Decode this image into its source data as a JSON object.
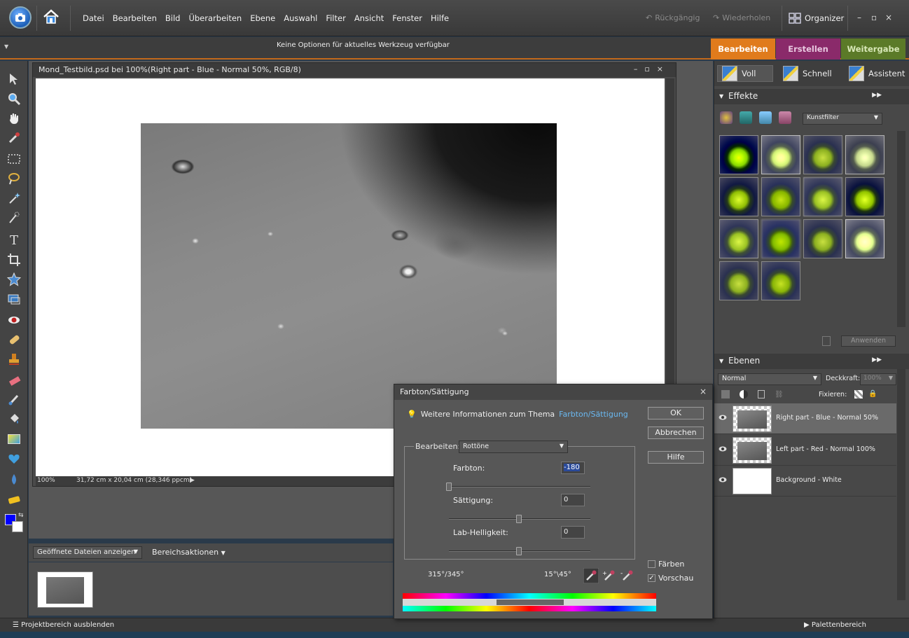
{
  "menubar": {
    "menus": [
      "Datei",
      "Bearbeiten",
      "Bild",
      "Überarbeiten",
      "Ebene",
      "Auswahl",
      "Filter",
      "Ansicht",
      "Fenster",
      "Hilfe"
    ],
    "undo_label": "Rückgängig",
    "redo_label": "Wiederholen",
    "organizer_label": "Organizer"
  },
  "options_bar": {
    "message": "Keine Optionen für aktuelles Werkzeug verfügbar",
    "tabs": [
      "Bearbeiten",
      "Erstellen",
      "Weitergabe"
    ]
  },
  "document": {
    "title": "Mond_Testbild.psd bei 100%(Right part - Blue - Normal 50%, RGB/8)",
    "zoom": "100%",
    "dimensions": "31,72 cm x 20,04 cm (28,346 ppcm)"
  },
  "project_bin": {
    "dropdown": "Geöffnete Dateien anzeigen",
    "actions_label": "Bereichsaktionen"
  },
  "statusbar": {
    "left": "Projektbereich ausblenden",
    "right": "Palettenbereich"
  },
  "palette": {
    "modes": [
      "Voll",
      "Schnell",
      "Assistent"
    ],
    "effects_title": "Effekte",
    "effects_category": "Kunstfilter",
    "apply_label": "Anwenden",
    "layers_title": "Ebenen",
    "blend_mode": "Normal",
    "opacity_label": "Deckkraft:",
    "opacity_value": "100%",
    "fix_label": "Fixieren:",
    "layers": [
      {
        "name": "Right part - Blue - Normal 50%"
      },
      {
        "name": "Left part - Red - Normal 100%"
      },
      {
        "name": "Background - White"
      }
    ]
  },
  "dialog": {
    "title": "Farbton/Sättigung",
    "info_text": "Weitere Informationen zum Thema",
    "info_link": "Farbton/Sättigung",
    "ok": "OK",
    "cancel": "Abbrechen",
    "help": "Hilfe",
    "edit_label": "Bearbeiten:",
    "edit_value": "Rottöne",
    "hue_label": "Farbton:",
    "hue_value": "-180",
    "sat_label": "Sättigung:",
    "sat_value": "0",
    "light_label": "Lab-Helligkeit:",
    "light_value": "0",
    "range_left": "315°/345°",
    "range_right": "15°\\45°",
    "colorize_label": "Färben",
    "preview_label": "Vorschau"
  }
}
